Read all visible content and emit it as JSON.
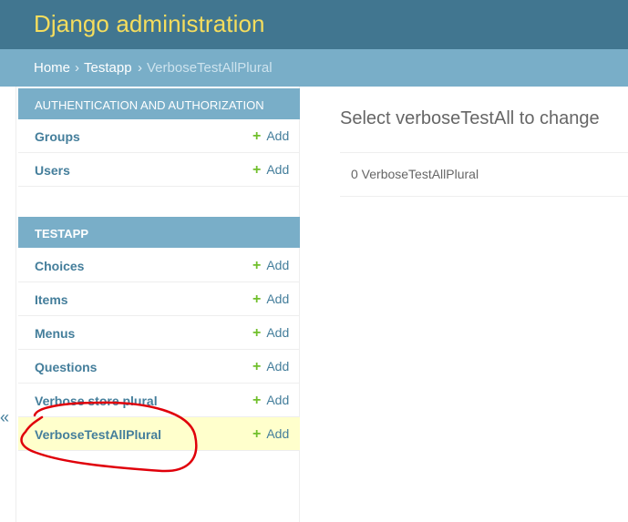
{
  "header": {
    "site_title": "Django administration"
  },
  "breadcrumbs": {
    "home": "Home",
    "sep": "›",
    "app": "Testapp",
    "current": "VerboseTestAllPlural"
  },
  "sidebar": {
    "collapse_icon": "«",
    "modules": [
      {
        "caption": "AUTHENTICATION AND AUTHORIZATION",
        "models": [
          {
            "name": "Groups",
            "add": "Add"
          },
          {
            "name": "Users",
            "add": "Add"
          }
        ]
      },
      {
        "caption": "TESTAPP",
        "models": [
          {
            "name": "Choices",
            "add": "Add"
          },
          {
            "name": "Items",
            "add": "Add"
          },
          {
            "name": "Menus",
            "add": "Add"
          },
          {
            "name": "Questions",
            "add": "Add"
          },
          {
            "name": "Verbose store plural",
            "add": "Add"
          },
          {
            "name": "VerboseTestAllPlural",
            "add": "Add"
          }
        ]
      }
    ]
  },
  "content": {
    "title": "Select verboseTestAll to change",
    "paginator": "0 VerboseTestAllPlural"
  },
  "icons": {
    "add": "+",
    "collapse": "double-chevron-left-icon"
  },
  "colors": {
    "header_bg": "#417690",
    "title_yellow": "#f5dd5d",
    "breadcrumb_bg": "#79aec8",
    "link_blue": "#447e9b",
    "add_green": "#70bf2b",
    "highlight_row": "#ffffcc",
    "annotation_red": "#e0000a"
  }
}
